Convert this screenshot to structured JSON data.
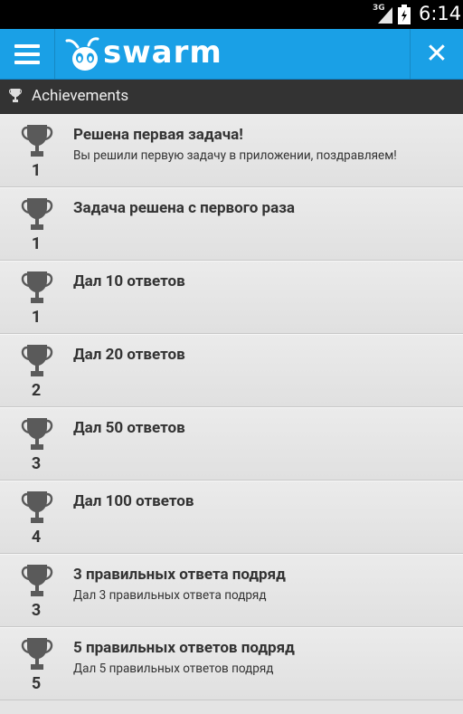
{
  "status": {
    "network": "3G",
    "time": "6:14"
  },
  "appbar": {
    "logo": "swarm",
    "menu_icon": "menu-icon",
    "close_icon": "close-icon"
  },
  "header": {
    "icon": "trophy-icon",
    "title": "Achievements"
  },
  "achievements": [
    {
      "title": "Решена первая задача!",
      "description": "Вы решили первую задачу в приложении, поздравляем!",
      "count": "1"
    },
    {
      "title": "Задача решена с первого раза",
      "description": "",
      "count": "1"
    },
    {
      "title": "Дал 10 ответов",
      "description": "",
      "count": "1"
    },
    {
      "title": "Дал 20 ответов",
      "description": "",
      "count": "2"
    },
    {
      "title": "Дал 50 ответов",
      "description": "",
      "count": "3"
    },
    {
      "title": "Дал 100 ответов",
      "description": "",
      "count": "4"
    },
    {
      "title": "3 правильных ответа подряд",
      "description": "Дал 3 правильных ответа подряд",
      "count": "3"
    },
    {
      "title": "5 правильных ответов подряд",
      "description": "Дал 5 правильных ответов подряд",
      "count": "5"
    }
  ],
  "colors": {
    "appbar": "#1aa0e6",
    "header": "#333333",
    "row": "#e4e4e4",
    "cup": "#5a5a5a"
  }
}
